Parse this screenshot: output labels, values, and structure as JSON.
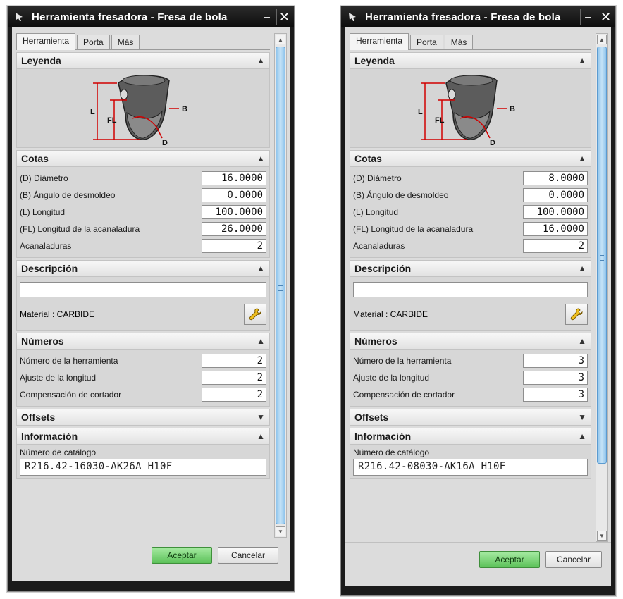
{
  "dialogs": [
    {
      "title": "Herramienta fresadora - Fresa de bola",
      "tabs": [
        "Herramienta",
        "Porta",
        "Más"
      ],
      "sections": {
        "legend": {
          "title": "Leyenda",
          "labels": {
            "L": "L",
            "FL": "FL",
            "B": "B",
            "D": "D"
          }
        },
        "dimensions": {
          "title": "Cotas",
          "rows": [
            {
              "label": "(D) Diámetro",
              "value": "16.0000"
            },
            {
              "label": "(B) Ángulo de desmoldeo",
              "value": "0.0000"
            },
            {
              "label": "(L) Longitud",
              "value": "100.0000"
            },
            {
              "label": "(FL) Longitud de la acanaladura",
              "value": "26.0000"
            },
            {
              "label": "Acanaladuras",
              "value": "2"
            }
          ]
        },
        "description": {
          "title": "Descripción",
          "text": "",
          "material": "Material : CARBIDE"
        },
        "numbers": {
          "title": "Números",
          "rows": [
            {
              "label": "Número de la herramienta",
              "value": "2"
            },
            {
              "label": "Ajuste de la longitud",
              "value": "2"
            },
            {
              "label": "Compensación de cortador",
              "value": "2"
            }
          ]
        },
        "offsets": {
          "title": "Offsets"
        },
        "info": {
          "title": "Información",
          "catalog_label": "Número de catálogo",
          "catalog_value": "R216.42-16030-AK26A H10F"
        }
      },
      "buttons": {
        "ok": "Aceptar",
        "cancel": "Cancelar"
      }
    },
    {
      "title": "Herramienta fresadora - Fresa de bola",
      "tabs": [
        "Herramienta",
        "Porta",
        "Más"
      ],
      "sections": {
        "legend": {
          "title": "Leyenda",
          "labels": {
            "L": "L",
            "FL": "FL",
            "B": "B",
            "D": "D"
          }
        },
        "dimensions": {
          "title": "Cotas",
          "rows": [
            {
              "label": "(D) Diámetro",
              "value": "8.0000"
            },
            {
              "label": "(B) Ángulo de desmoldeo",
              "value": "0.0000"
            },
            {
              "label": "(L) Longitud",
              "value": "100.0000"
            },
            {
              "label": "(FL) Longitud de la acanaladura",
              "value": "16.0000"
            },
            {
              "label": "Acanaladuras",
              "value": "2"
            }
          ]
        },
        "description": {
          "title": "Descripción",
          "text": "",
          "material": "Material : CARBIDE"
        },
        "numbers": {
          "title": "Números",
          "rows": [
            {
              "label": "Número de la herramienta",
              "value": "3"
            },
            {
              "label": "Ajuste de la longitud",
              "value": "3"
            },
            {
              "label": "Compensación de cortador",
              "value": "3"
            }
          ]
        },
        "offsets": {
          "title": "Offsets"
        },
        "info": {
          "title": "Información",
          "catalog_label": "Número de catálogo",
          "catalog_value": "R216.42-08030-AK16A H10F"
        }
      },
      "buttons": {
        "ok": "Aceptar",
        "cancel": "Cancelar"
      }
    }
  ],
  "icons": {
    "app": "nx-app-icon",
    "minimize": "minimize-icon",
    "close": "close-icon",
    "collapse": "chevron-up-icon",
    "expand": "chevron-down-icon",
    "wrench": "wrench-icon"
  },
  "colors": {
    "titlebar": "#111111",
    "panel": "#dcdcdc",
    "section_header": "#ececec",
    "scroll_thumb": "#9fd0f2",
    "ok_button": "#7cd67a"
  }
}
